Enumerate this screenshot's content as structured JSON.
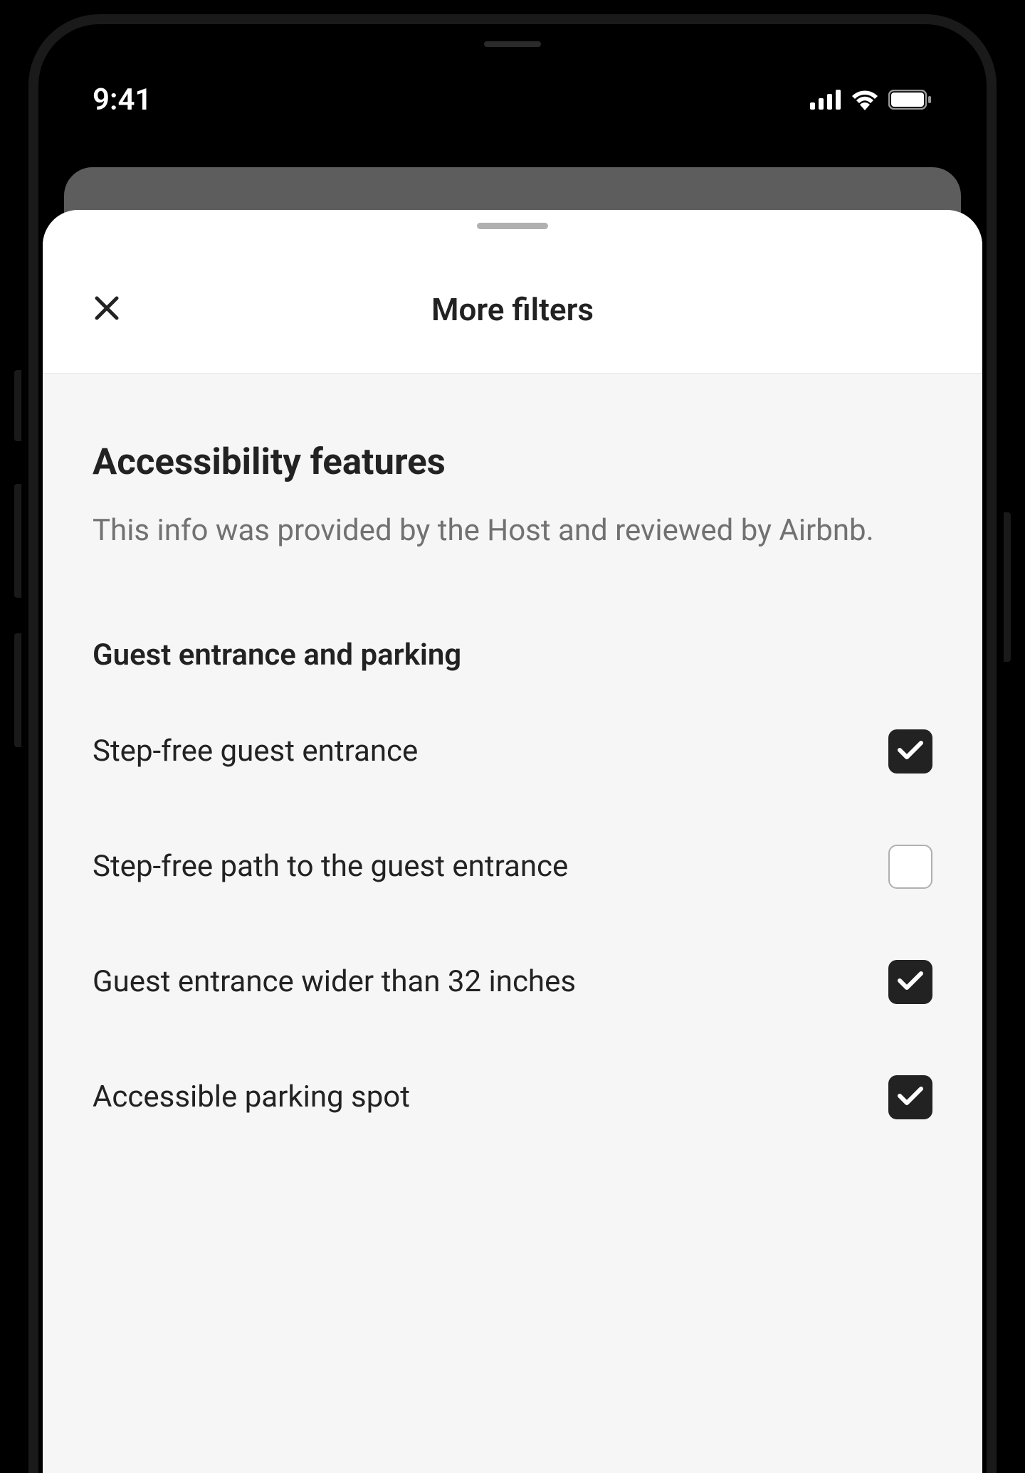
{
  "status_bar": {
    "time": "9:41"
  },
  "modal": {
    "title": "More filters",
    "section_title": "Accessibility features",
    "section_description": "This info was provided by the Host and reviewed by Airbnb.",
    "subsection_title": "Guest entrance and parking",
    "filters": [
      {
        "label": "Step-free guest entrance",
        "checked": true
      },
      {
        "label": "Step-free path to the guest entrance",
        "checked": false
      },
      {
        "label": "Guest entrance wider than 32 inches",
        "checked": true
      },
      {
        "label": "Accessible parking spot",
        "checked": true
      }
    ]
  }
}
